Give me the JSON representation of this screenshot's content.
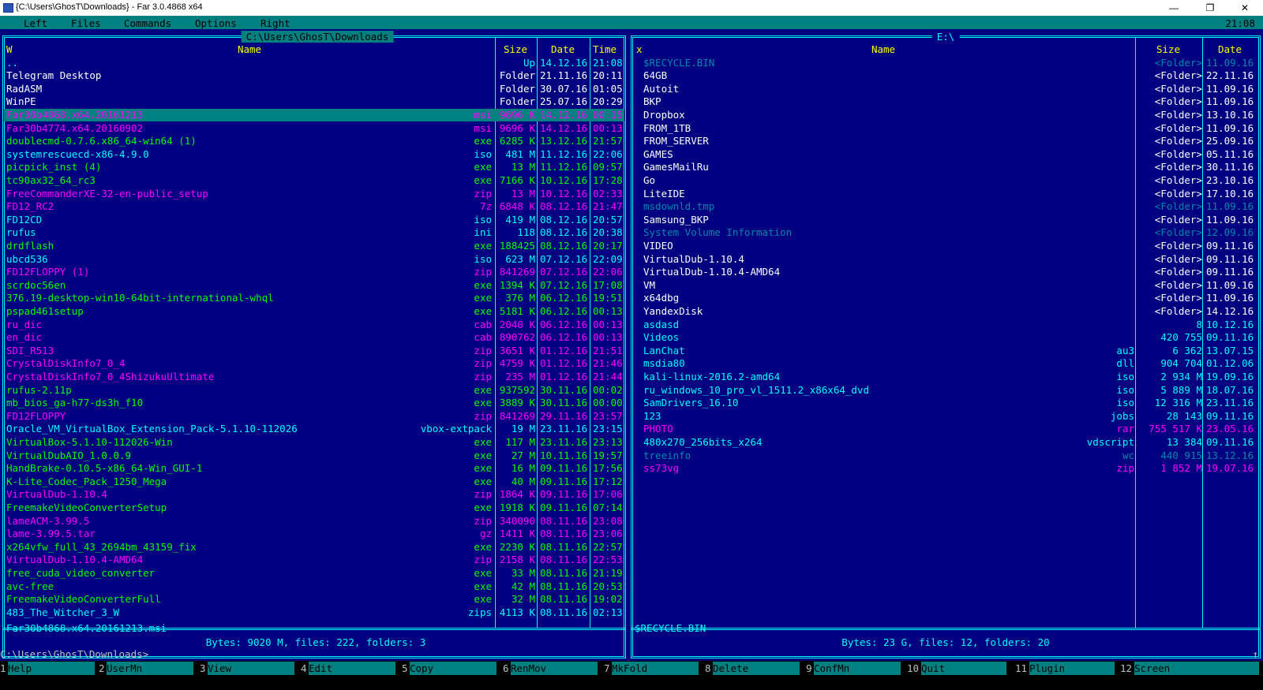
{
  "window": {
    "title": "{C:\\Users\\GhosT\\Downloads} - Far 3.0.4868 x64",
    "minimize_glyph": "—",
    "maximize_glyph": "❐",
    "close_glyph": "✕"
  },
  "menu": {
    "items": [
      "Left",
      "Files",
      "Commands",
      "Options",
      "Right"
    ],
    "clock": "21:08"
  },
  "left_panel": {
    "title": "C:\\Users\\GhosT\\Downloads",
    "headers": {
      "mode": "W",
      "name": "Name",
      "size": "Size",
      "date": "Date",
      "time": "Time"
    },
    "files": [
      {
        "name": "..",
        "ext": "",
        "size": "Up",
        "date": "14.12.16",
        "time": "21:08",
        "type": "up"
      },
      {
        "name": "Telegram Desktop",
        "ext": "",
        "size": "Folder",
        "date": "21.11.16",
        "time": "20:11",
        "type": "dir"
      },
      {
        "name": "RadASM",
        "ext": "",
        "size": "Folder",
        "date": "30.07.16",
        "time": "01:05",
        "type": "dir"
      },
      {
        "name": "WinPE",
        "ext": "",
        "size": "Folder",
        "date": "25.07.16",
        "time": "20:29",
        "type": "dir"
      },
      {
        "name": "Far30b4868.x64.20161213",
        "ext": "msi",
        "size": "9696 K",
        "date": "14.12.16",
        "time": "00:15",
        "type": "cursor"
      },
      {
        "name": "Far30b4774.x64.20160902",
        "ext": "msi",
        "size": "9696 K",
        "date": "14.12.16",
        "time": "00:13",
        "type": "arc"
      },
      {
        "name": "doublecmd-0.7.6.x86_64-win64 (1)",
        "ext": "exe",
        "size": "6285 K",
        "date": "13.12.16",
        "time": "21:57",
        "type": "exe"
      },
      {
        "name": "systemrescuecd-x86-4.9.0",
        "ext": "iso",
        "size": "481 M",
        "date": "11.12.16",
        "time": "22:06",
        "type": "iso"
      },
      {
        "name": "picpick_inst (4)",
        "ext": "exe",
        "size": "13 M",
        "date": "11.12.16",
        "time": "09:57",
        "type": "exe"
      },
      {
        "name": "tc90ax32_64_rc3",
        "ext": "exe",
        "size": "7166 K",
        "date": "10.12.16",
        "time": "17:28",
        "type": "exe"
      },
      {
        "name": "FreeCommanderXE-32-en-public_setup",
        "ext": "zip",
        "size": "13 M",
        "date": "10.12.16",
        "time": "02:33",
        "type": "arc"
      },
      {
        "name": "FD12_RC2",
        "ext": "7z",
        "size": "6848 K",
        "date": "08.12.16",
        "time": "21:47",
        "type": "arc"
      },
      {
        "name": "FD12CD",
        "ext": "iso",
        "size": "419 M",
        "date": "08.12.16",
        "time": "20:57",
        "type": "iso"
      },
      {
        "name": "rufus",
        "ext": "ini",
        "size": "118",
        "date": "08.12.16",
        "time": "20:38",
        "type": "iso"
      },
      {
        "name": "drdflash",
        "ext": "exe",
        "size": "188425",
        "date": "08.12.16",
        "time": "20:17",
        "type": "exe"
      },
      {
        "name": "ubcd536",
        "ext": "iso",
        "size": "623 M",
        "date": "07.12.16",
        "time": "22:09",
        "type": "iso"
      },
      {
        "name": "FD12FLOPPY (1)",
        "ext": "zip",
        "size": "841269",
        "date": "07.12.16",
        "time": "22:06",
        "type": "arc"
      },
      {
        "name": "scrdoc56en",
        "ext": "exe",
        "size": "1394 K",
        "date": "07.12.16",
        "time": "17:08",
        "type": "exe"
      },
      {
        "name": "376.19-desktop-win10-64bit-international-whql",
        "ext": "exe",
        "size": "376 M",
        "date": "06.12.16",
        "time": "19:51",
        "type": "exe"
      },
      {
        "name": "pspad461setup",
        "ext": "exe",
        "size": "5181 K",
        "date": "06.12.16",
        "time": "00:13",
        "type": "exe"
      },
      {
        "name": "ru_dic",
        "ext": "cab",
        "size": "2040 K",
        "date": "06.12.16",
        "time": "00:13",
        "type": "arc"
      },
      {
        "name": "en_dic",
        "ext": "cab",
        "size": "890762",
        "date": "06.12.16",
        "time": "00:13",
        "type": "arc"
      },
      {
        "name": "SDI_R513",
        "ext": "zip",
        "size": "3651 K",
        "date": "01.12.16",
        "time": "21:51",
        "type": "arc"
      },
      {
        "name": "CrystalDiskInfo7_0_4",
        "ext": "zip",
        "size": "4759 K",
        "date": "01.12.16",
        "time": "21:46",
        "type": "arc"
      },
      {
        "name": "CrystalDiskInfo7_0_4ShizukuUltimate",
        "ext": "zip",
        "size": "235 M",
        "date": "01.12.16",
        "time": "21:44",
        "type": "arc"
      },
      {
        "name": "rufus-2.11p",
        "ext": "exe",
        "size": "937592",
        "date": "30.11.16",
        "time": "00:02",
        "type": "exe"
      },
      {
        "name": "mb_bios_ga-h77-ds3h_f10",
        "ext": "exe",
        "size": "3889 K",
        "date": "30.11.16",
        "time": "00:00",
        "type": "exe"
      },
      {
        "name": "FD12FLOPPY",
        "ext": "zip",
        "size": "841269",
        "date": "29.11.16",
        "time": "23:57",
        "type": "arc"
      },
      {
        "name": "Oracle_VM_VirtualBox_Extension_Pack-5.1.10-112026",
        "ext": "vbox-extpack",
        "size": "19 M",
        "date": "23.11.16",
        "time": "23:15",
        "type": "iso"
      },
      {
        "name": "VirtualBox-5.1.10-112026-Win",
        "ext": "exe",
        "size": "117 M",
        "date": "23.11.16",
        "time": "23:13",
        "type": "exe"
      },
      {
        "name": "VirtualDubAIO_1.0.0.9",
        "ext": "exe",
        "size": "27 M",
        "date": "10.11.16",
        "time": "19:57",
        "type": "exe"
      },
      {
        "name": "HandBrake-0.10.5-x86_64-Win_GUI-1",
        "ext": "exe",
        "size": "16 M",
        "date": "09.11.16",
        "time": "17:56",
        "type": "exe"
      },
      {
        "name": "K-Lite_Codec_Pack_1250_Mega",
        "ext": "exe",
        "size": "40 M",
        "date": "09.11.16",
        "time": "17:12",
        "type": "exe"
      },
      {
        "name": "VirtualDub-1.10.4",
        "ext": "zip",
        "size": "1864 K",
        "date": "09.11.16",
        "time": "17:06",
        "type": "arc"
      },
      {
        "name": "FreemakeVideoConverterSetup",
        "ext": "exe",
        "size": "1918 K",
        "date": "09.11.16",
        "time": "07:14",
        "type": "exe"
      },
      {
        "name": "lameACM-3.99.5",
        "ext": "zip",
        "size": "340090",
        "date": "08.11.16",
        "time": "23:08",
        "type": "arc"
      },
      {
        "name": "lame-3.99.5.tar",
        "ext": "gz",
        "size": "1411 K",
        "date": "08.11.16",
        "time": "23:06",
        "type": "arc"
      },
      {
        "name": "x264vfw_full_43_2694bm_43159_fix",
        "ext": "exe",
        "size": "2230 K",
        "date": "08.11.16",
        "time": "22:57",
        "type": "exe"
      },
      {
        "name": "VirtualDub-1.10.4-AMD64",
        "ext": "zip",
        "size": "2158 K",
        "date": "08.11.16",
        "time": "22:53",
        "type": "arc"
      },
      {
        "name": "free_cuda_video_converter",
        "ext": "exe",
        "size": "33 M",
        "date": "08.11.16",
        "time": "21:19",
        "type": "exe"
      },
      {
        "name": "avc-free",
        "ext": "exe",
        "size": "42 M",
        "date": "08.11.16",
        "time": "20:53",
        "type": "exe"
      },
      {
        "name": "FreemakeVideoConverterFull",
        "ext": "exe",
        "size": "32 M",
        "date": "08.11.16",
        "time": "19:02",
        "type": "exe"
      },
      {
        "name": "483_The_Witcher_3_W",
        "ext": "zips",
        "size": "4113 K",
        "date": "08.11.16",
        "time": "02:13",
        "type": "iso"
      }
    ],
    "info_line": "Far30b4868.x64.20161213.msi",
    "stats": "Bytes: 9020 M, files: 222, folders: 3"
  },
  "right_panel": {
    "title": "E:\\",
    "headers": {
      "mode": "x",
      "name": "Name",
      "size": "Size",
      "date": "Date"
    },
    "files": [
      {
        "name": "$RECYCLE.BIN",
        "ext": "",
        "size": "<Folder>",
        "date": "11.09.16",
        "type": "hid"
      },
      {
        "name": "64GB",
        "ext": "",
        "size": "<Folder>",
        "date": "22.11.16",
        "type": "dir"
      },
      {
        "name": "Autoit",
        "ext": "",
        "size": "<Folder>",
        "date": "11.09.16",
        "type": "dir"
      },
      {
        "name": "BKP",
        "ext": "",
        "size": "<Folder>",
        "date": "11.09.16",
        "type": "dir"
      },
      {
        "name": "Dropbox",
        "ext": "",
        "size": "<Folder>",
        "date": "13.10.16",
        "type": "dir"
      },
      {
        "name": "FROM_1TB",
        "ext": "",
        "size": "<Folder>",
        "date": "11.09.16",
        "type": "dir"
      },
      {
        "name": "FROM_SERVER",
        "ext": "",
        "size": "<Folder>",
        "date": "25.09.16",
        "type": "dir"
      },
      {
        "name": "GAMES",
        "ext": "",
        "size": "<Folder>",
        "date": "05.11.16",
        "type": "dir"
      },
      {
        "name": "GamesMailRu",
        "ext": "",
        "size": "<Folder>",
        "date": "30.11.16",
        "type": "dir"
      },
      {
        "name": "Go",
        "ext": "",
        "size": "<Folder>",
        "date": "23.10.16",
        "type": "dir"
      },
      {
        "name": "LiteIDE",
        "ext": "",
        "size": "<Folder>",
        "date": "17.10.16",
        "type": "dir"
      },
      {
        "name": "msdownld.tmp",
        "ext": "",
        "size": "<Folder>",
        "date": "11.09.16",
        "type": "hid"
      },
      {
        "name": "Samsung_BKP",
        "ext": "",
        "size": "<Folder>",
        "date": "11.09.16",
        "type": "dir"
      },
      {
        "name": "System Volume Information",
        "ext": "",
        "size": "<Folder>",
        "date": "12.09.16",
        "type": "hid"
      },
      {
        "name": "VIDEO",
        "ext": "",
        "size": "<Folder>",
        "date": "09.11.16",
        "type": "dir"
      },
      {
        "name": "VirtualDub-1.10.4",
        "ext": "",
        "size": "<Folder>",
        "date": "09.11.16",
        "type": "dir"
      },
      {
        "name": "VirtualDub-1.10.4-AMD64",
        "ext": "",
        "size": "<Folder>",
        "date": "09.11.16",
        "type": "dir"
      },
      {
        "name": "VM",
        "ext": "",
        "size": "<Folder>",
        "date": "11.09.16",
        "type": "dir"
      },
      {
        "name": "x64dbg",
        "ext": "",
        "size": "<Folder>",
        "date": "11.09.16",
        "type": "dir"
      },
      {
        "name": "YandexDisk",
        "ext": "",
        "size": "<Folder>",
        "date": "14.12.16",
        "type": "dir"
      },
      {
        "name": "asdasd",
        "ext": "",
        "size": "8",
        "date": "10.12.16",
        "type": "iso"
      },
      {
        "name": "Videos",
        "ext": "",
        "size": "420 755",
        "date": "09.11.16",
        "type": "iso"
      },
      {
        "name": "LanChat",
        "ext": "au3",
        "size": "6 362",
        "date": "13.07.15",
        "type": "iso"
      },
      {
        "name": "msdia80",
        "ext": "dll",
        "size": "904 704",
        "date": "01.12.06",
        "type": "iso"
      },
      {
        "name": "kali-linux-2016.2-amd64",
        "ext": "iso",
        "size": "2 934 M",
        "date": "19.09.16",
        "type": "iso"
      },
      {
        "name": "ru_windows_10_pro_vl_1511.2_x86x64_dvd",
        "ext": "iso",
        "size": "5 889 M",
        "date": "18.07.16",
        "type": "iso"
      },
      {
        "name": "SamDrivers_16.10",
        "ext": "iso",
        "size": "12 316 M",
        "date": "23.11.16",
        "type": "iso"
      },
      {
        "name": "123",
        "ext": "jobs",
        "size": "28 143",
        "date": "09.11.16",
        "type": "iso"
      },
      {
        "name": "PHOTO",
        "ext": "rar",
        "size": "755 517 K",
        "date": "23.05.16",
        "type": "arc"
      },
      {
        "name": "480x270_256bits_x264",
        "ext": "vdscript",
        "size": "13 384",
        "date": "09.11.16",
        "type": "iso"
      },
      {
        "name": "treeinfo",
        "ext": "wc",
        "size": "440 915",
        "date": "13.12.16",
        "type": "hid"
      },
      {
        "name": "ss73vg",
        "ext": "zip",
        "size": "1 852 M",
        "date": "19.07.16",
        "type": "arc"
      }
    ],
    "info_line": "$RECYCLE.BIN",
    "stats": "Bytes: 23 G, files: 12, folders: 20"
  },
  "command_line": {
    "prompt": "C:\\Users\\GhosT\\Downloads>",
    "scroll_glyph": "↑"
  },
  "keybar": [
    {
      "num": "1",
      "label": "Help"
    },
    {
      "num": "2",
      "label": "UserMn"
    },
    {
      "num": "3",
      "label": "View"
    },
    {
      "num": "4",
      "label": "Edit"
    },
    {
      "num": "5",
      "label": "Copy"
    },
    {
      "num": "6",
      "label": "RenMov"
    },
    {
      "num": "7",
      "label": "MkFold"
    },
    {
      "num": "8",
      "label": "Delete"
    },
    {
      "num": "9",
      "label": "ConfMn"
    },
    {
      "num": "10",
      "label": "Quit"
    },
    {
      "num": "11",
      "label": "Plugin"
    },
    {
      "num": "12",
      "label": "Screen"
    }
  ],
  "colors": {
    "panel_bg": "#000080",
    "frame": "#00ffff",
    "header": "#ffff00",
    "cursor_bg": "#008080",
    "folder": "#ffffff",
    "executable": "#00ff00",
    "archive": "#ff00ff",
    "document": "#00ffff",
    "hidden": "#0088aa"
  }
}
